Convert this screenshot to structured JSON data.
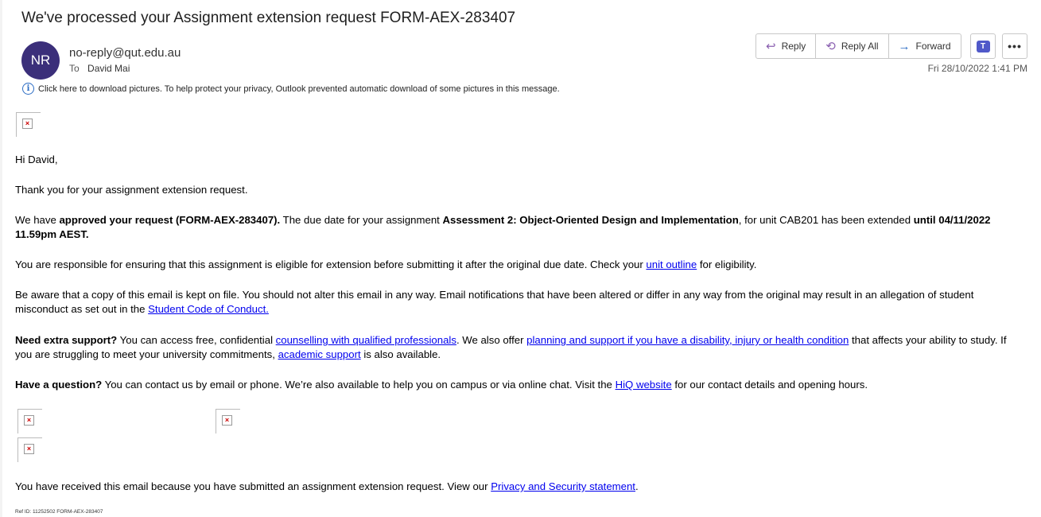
{
  "subject": "We've processed your Assignment extension request FORM-AEX-283407",
  "sender": {
    "initials": "NR",
    "email": "no-reply@qut.edu.au",
    "to_label": "To",
    "to_name": "David Mai",
    "avatar_color": "#3b2f7a"
  },
  "datetime": "Fri 28/10/2022 1:41 PM",
  "actions": {
    "reply": "Reply",
    "reply_all": "Reply All",
    "forward": "Forward",
    "more": "•••"
  },
  "privacy_note": "Click here to download pictures. To help protect your privacy, Outlook prevented automatic download of some pictures in this message.",
  "body": {
    "greeting": "Hi David,",
    "thanks": "Thank you for your assignment extension request.",
    "p1": {
      "t1": "We have ",
      "b1": "approved your request (FORM-AEX-283407).",
      "t2": " The due date for your assignment ",
      "b2": "Assessment 2: Object-Oriented Design and Implementation",
      "t3": ", for unit CAB201 has been extended ",
      "b3": "until 04/11/2022 11.59pm AEST."
    },
    "p2": {
      "t1": "You are responsible for ensuring that this assignment is eligible for extension before submitting it after the original due date. Check your ",
      "link": "unit outline",
      "t2": " for eligibility."
    },
    "p3": {
      "t1": "Be aware that a copy of this email is kept on file. You should not alter this email in any way. Email notifications that have been altered or differ in any way from the original may result in an allegation of student misconduct as set out in the ",
      "link": "Student Code of Conduct."
    },
    "p4": {
      "b1": "Need extra support?",
      "t1": " You can access free, confidential ",
      "link1": "counselling with qualified professionals",
      "t2": ". We also offer ",
      "link2": "planning and support if you have a disability, injury or health condition",
      "t3": " that affects your ability to study. If you are struggling to meet your university commitments, ",
      "link3": "academic support",
      "t4": " is also available."
    },
    "p5": {
      "b1": "Have a question?",
      "t1": " You can contact us by email or phone. We’re also available to help you on campus or via online chat. Visit the ",
      "link": "HiQ website",
      "t2": " for our contact details and opening hours."
    },
    "footer": {
      "t1": "You have received this email because you have submitted an assignment extension request. View our ",
      "link": "Privacy and Security statement",
      "t2": "."
    },
    "ref": "Ref ID: 11252502 FORM-AEX-283407"
  }
}
